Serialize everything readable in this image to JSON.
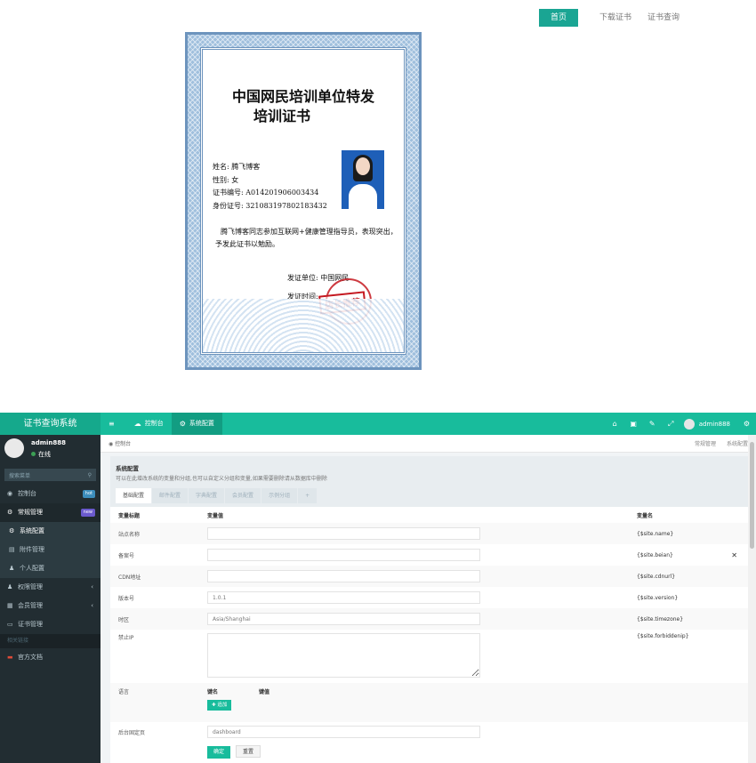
{
  "topnav": {
    "home": "首页",
    "download": "下载证书",
    "query": "证书查询"
  },
  "certificate": {
    "title_line1": "中国网民培训单位特发",
    "title_line2": "培训证书",
    "name": "姓名: 腾飞博客",
    "gender": "性别: 女",
    "cert_no": "证书编号: A014201906003434",
    "id_no": "身份证号: 321083197802183432",
    "body": "腾飞博客同志参加互联网+健康管理指导员，表现突出，予发此证书以勉励。",
    "issuer": "发证单位: 中国网民",
    "issue_time": "发证时间:",
    "stamp_text": "店长推荐"
  },
  "admin": {
    "logo": "证书查询系统",
    "tabs": [
      {
        "icon": "≡",
        "label": ""
      },
      {
        "icon": "☁",
        "label": "控制台"
      },
      {
        "icon": "⚙",
        "label": "系统配置"
      }
    ],
    "header_icons": [
      "⌂",
      "▣",
      "✎",
      "⤢"
    ],
    "username": "admin888",
    "sidebar": {
      "user": "admin888",
      "status": "在线",
      "search_placeholder": "搜索菜单",
      "items": [
        {
          "icon": "◉",
          "label": "控制台",
          "badge": "hot",
          "badge_color": "#3c8dbc"
        },
        {
          "icon": "⚙",
          "label": "常规管理",
          "badge": "new",
          "badge_color": "#6a5acd"
        },
        {
          "icon": "⚙",
          "label": "系统配置"
        },
        {
          "icon": "▤",
          "label": "附件管理"
        },
        {
          "icon": "♟",
          "label": "个人配置"
        },
        {
          "icon": "♟",
          "label": "权限管理",
          "caret": "‹"
        },
        {
          "icon": "▦",
          "label": "会员管理",
          "caret": "‹"
        },
        {
          "icon": "▭",
          "label": "证书管理"
        }
      ],
      "section": "相关链接",
      "link": {
        "icon": "▬",
        "label": "官方文档"
      }
    },
    "breadcrumb": {
      "home": "控制台",
      "right1": "常规管理",
      "right2": "系统配置"
    },
    "panel": {
      "title": "系统配置",
      "desc": "可以在此增改系统的变量和分组,也可以自定义分组和变量,如果需要删除请从数据库中删除",
      "tabs": [
        "基础配置",
        "邮件配置",
        "字典配置",
        "会员配置",
        "示例分组",
        "+"
      ],
      "columns": {
        "title": "变量标题",
        "value": "变量值",
        "name": "变量名"
      },
      "rows": [
        {
          "title": "站点名称",
          "value": "",
          "name": "{$site.name}"
        },
        {
          "title": "备案号",
          "value": "",
          "name": "{$site.beian}"
        },
        {
          "title": "CDN地址",
          "value": "",
          "name": "{$site.cdnurl}"
        },
        {
          "title": "版本号",
          "value": "1.0.1",
          "name": "{$site.version}"
        },
        {
          "title": "时区",
          "value": "Asia/Shanghai",
          "name": "{$site.timezone}"
        },
        {
          "title": "禁止IP",
          "value": "",
          "name": "{$site.forbiddenip}"
        }
      ],
      "lang_row": {
        "title": "语言",
        "key": "键名",
        "val": "键值",
        "add": "✚ 追加"
      },
      "backend_row": {
        "title": "后台固定页",
        "value": "dashboard"
      },
      "ok": "确定",
      "reset": "重置"
    }
  }
}
